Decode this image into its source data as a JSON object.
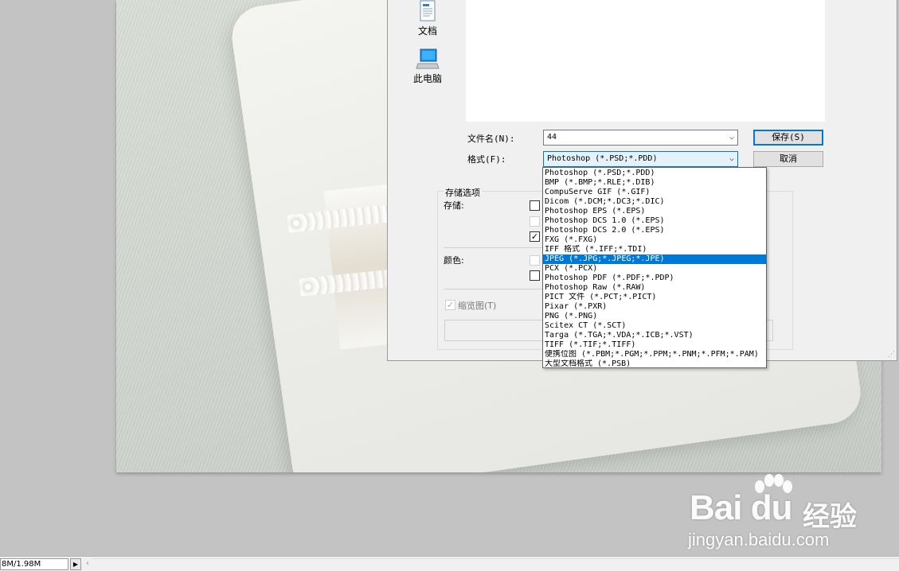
{
  "sidebar": {
    "items": [
      {
        "label": "文档",
        "icon": "document-icon"
      },
      {
        "label": "此电脑",
        "icon": "computer-icon"
      }
    ]
  },
  "save_dialog": {
    "filename_label": "文件名(N):",
    "filename_value": "44",
    "format_label": "格式(F):",
    "format_value": "Photoshop (*.PSD;*.PDD)",
    "save_button": "保存(S)",
    "cancel_button": "取消",
    "save_options_title": "存储选项",
    "store_label": "存储:",
    "color_label": "颜色:",
    "thumbnail_label": "缩览图(T)",
    "thumbnail_checked": true
  },
  "format_dropdown": {
    "selected_index": 8,
    "options": [
      "Photoshop (*.PSD;*.PDD)",
      "BMP (*.BMP;*.RLE;*.DIB)",
      "CompuServe GIF (*.GIF)",
      "Dicom (*.DCM;*.DC3;*.DIC)",
      "Photoshop EPS (*.EPS)",
      "Photoshop DCS 1.0 (*.EPS)",
      "Photoshop DCS 2.0 (*.EPS)",
      "FXG (*.FXG)",
      "IFF 格式 (*.IFF;*.TDI)",
      "JPEG (*.JPG;*.JPEG;*.JPE)",
      "PCX (*.PCX)",
      "Photoshop PDF (*.PDF;*.PDP)",
      "Photoshop Raw (*.RAW)",
      "PICT 文件 (*.PCT;*.PICT)",
      "Pixar (*.PXR)",
      "PNG (*.PNG)",
      "Scitex CT (*.SCT)",
      "Targa (*.TGA;*.VDA;*.ICB;*.VST)",
      "TIFF (*.TIF;*.TIFF)",
      "便携位图 (*.PBM;*.PGM;*.PPM;*.PNM;*.PFM;*.PAM)",
      "大型文档格式 (*.PSB)"
    ],
    "highlighted": "JPEG (*.JPG;*.JPEG;*.JPE)"
  },
  "status_bar": {
    "doc_size": "8M/1.98M"
  },
  "watermark": {
    "brand": "Bai du",
    "brand_cn": "经验",
    "url": "jingyan.baidu.com"
  },
  "colors": {
    "accent": "#0078d7",
    "dialog_bg": "#f0f0f0",
    "workspace_bg": "#c3c3c3"
  }
}
